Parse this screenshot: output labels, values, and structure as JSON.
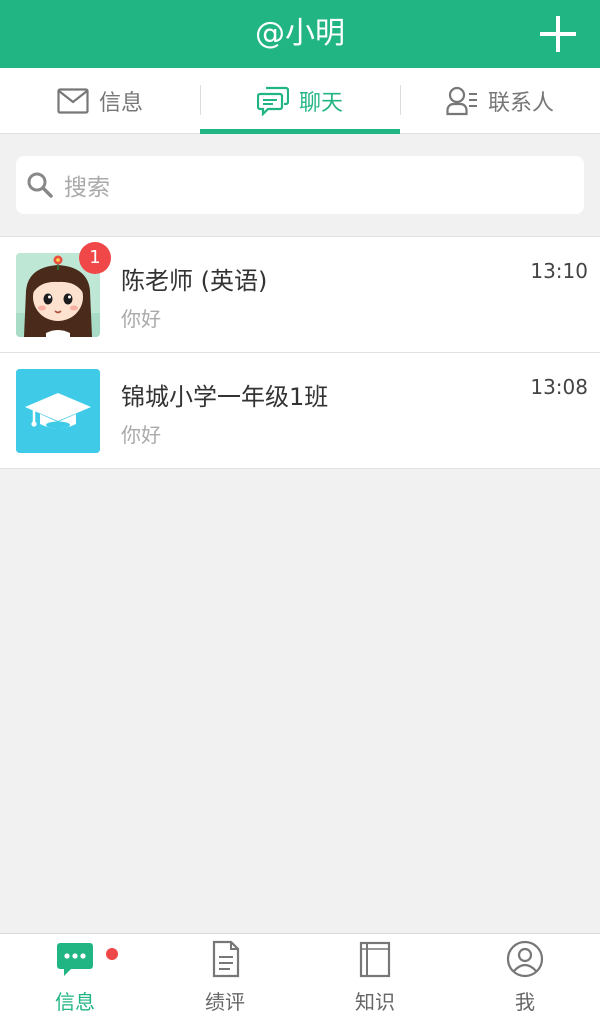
{
  "header": {
    "title": "@小明"
  },
  "tabs": [
    {
      "label": "信息",
      "icon": "mail-icon"
    },
    {
      "label": "聊天",
      "icon": "chat-icon",
      "active": true
    },
    {
      "label": "联系人",
      "icon": "contacts-icon"
    }
  ],
  "search": {
    "placeholder": "搜索"
  },
  "chats": [
    {
      "name": "陈老师 (英语)",
      "message": "你好",
      "time": "13:10",
      "unread": "1",
      "avatar": "girl-avatar"
    },
    {
      "name": "锦城小学一年级1班",
      "message": "你好",
      "time": "13:08",
      "avatar": "graduation-cap-icon"
    }
  ],
  "bottom_nav": [
    {
      "label": "信息",
      "icon": "message-icon",
      "active": true,
      "dot": true
    },
    {
      "label": "绩评",
      "icon": "document-icon"
    },
    {
      "label": "知识",
      "icon": "book-icon"
    },
    {
      "label": "我",
      "icon": "user-icon"
    }
  ],
  "colors": {
    "primary": "#22b584",
    "badge": "#f04848",
    "background": "#f1f1f1"
  }
}
